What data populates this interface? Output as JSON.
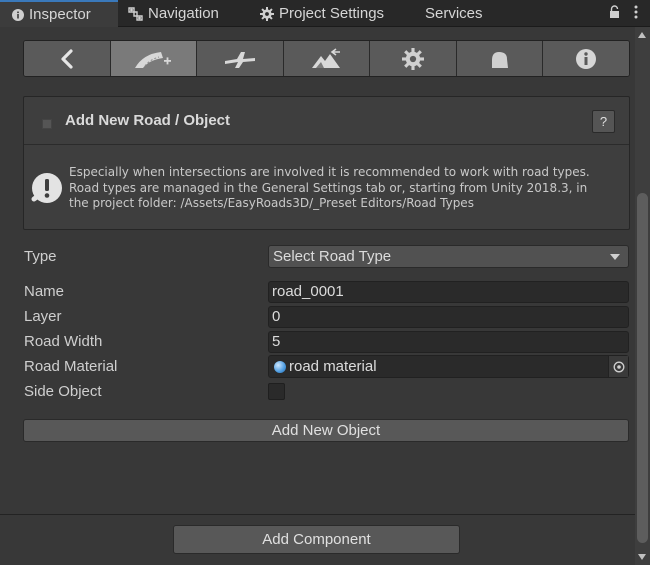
{
  "tabs": [
    {
      "label": "Inspector",
      "icon": "info-icon"
    },
    {
      "label": "Navigation",
      "icon": "navigation-icon"
    },
    {
      "label": "Project Settings",
      "icon": "gear-icon"
    },
    {
      "label": "Services",
      "icon": ""
    }
  ],
  "toolbar": {
    "buttons": [
      {
        "icon": "back-arrow-icon",
        "active": false
      },
      {
        "icon": "add-road-icon",
        "active": true
      },
      {
        "icon": "road-network-icon",
        "active": false
      },
      {
        "icon": "terrain-icon",
        "active": false
      },
      {
        "icon": "gear-icon",
        "active": false
      },
      {
        "icon": "object-icon",
        "active": false
      },
      {
        "icon": "info-icon",
        "active": false
      }
    ]
  },
  "header": {
    "title": "Add New Road / Object",
    "help_label": "?"
  },
  "info": {
    "line1": "Especially when intersections are involved it is recommended to work with road types.",
    "line2": "Road types are managed in the General Settings tab or, starting from Unity 2018.3, in",
    "line3": "the project folder: /Assets/EasyRoads3D/_Preset Editors/Road Types"
  },
  "form": {
    "type_label": "Type",
    "type_value": "Select Road Type",
    "name_label": "Name",
    "name_value": "road_0001",
    "layer_label": "Layer",
    "layer_value": "0",
    "width_label": "Road Width",
    "width_value": "5",
    "material_label": "Road Material",
    "material_value": "road material",
    "side_label": "Side Object",
    "side_checked": false
  },
  "actions": {
    "add_object_label": "Add New Object",
    "add_component_label": "Add Component"
  },
  "colors": {
    "background": "#383838",
    "tab_accent": "#3a79bb",
    "active_tool": "#7a7a7a"
  }
}
